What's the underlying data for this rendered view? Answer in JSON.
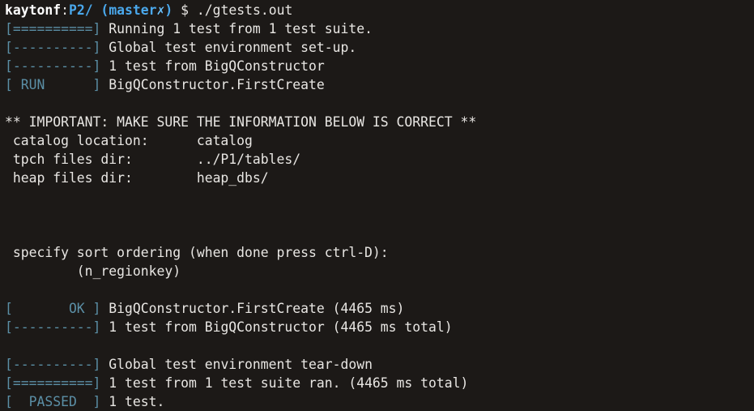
{
  "prompt": {
    "user": "kaytonf",
    "sep": ":",
    "dir": "P2/",
    "branch_open": " (",
    "branch": "master",
    "dirty_mark": "✗",
    "branch_close": ")",
    "symbol": " $ ",
    "command": "./gtests.out"
  },
  "lines": [
    {
      "tag": "[==========]",
      "text": " Running 1 test from 1 test suite."
    },
    {
      "tag": "[----------]",
      "text": " Global test environment set-up."
    },
    {
      "tag": "[----------]",
      "text": " 1 test from BigQConstructor"
    },
    {
      "tag": "[ RUN      ]",
      "text": " BigQConstructor.FirstCreate"
    },
    {
      "tag": "",
      "text": ""
    },
    {
      "tag": "",
      "text": "** IMPORTANT: MAKE SURE THE INFORMATION BELOW IS CORRECT **"
    },
    {
      "tag": "",
      "text": " catalog location:      catalog"
    },
    {
      "tag": "",
      "text": " tpch files dir:        ../P1/tables/"
    },
    {
      "tag": "",
      "text": " heap files dir:        heap_dbs/"
    },
    {
      "tag": "",
      "text": ""
    },
    {
      "tag": "",
      "text": ""
    },
    {
      "tag": "",
      "text": ""
    },
    {
      "tag": "",
      "text": " specify sort ordering (when done press ctrl-D):"
    },
    {
      "tag": "",
      "text": "         (n_regionkey)"
    },
    {
      "tag": "",
      "text": ""
    },
    {
      "tag": "[       OK ]",
      "text": " BigQConstructor.FirstCreate (4465 ms)"
    },
    {
      "tag": "[----------]",
      "text": " 1 test from BigQConstructor (4465 ms total)"
    },
    {
      "tag": "",
      "text": ""
    },
    {
      "tag": "[----------]",
      "text": " Global test environment tear-down"
    },
    {
      "tag": "[==========]",
      "text": " 1 test from 1 test suite ran. (4465 ms total)"
    },
    {
      "tag": "[  PASSED  ]",
      "text": " 1 test."
    }
  ]
}
